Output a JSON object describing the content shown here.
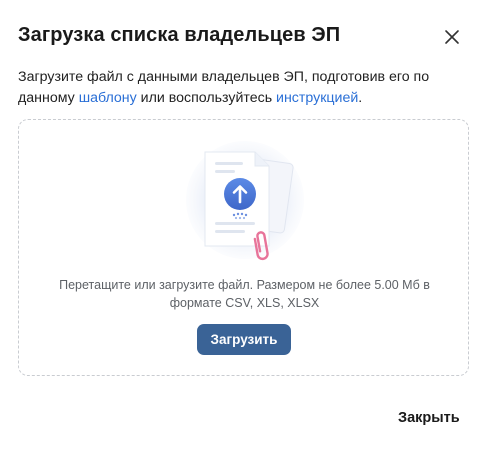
{
  "dialog": {
    "title": "Загрузка списка владельцев ЭП",
    "close_icon": "close-icon"
  },
  "description": {
    "text_before_template": "Загрузите файл с данными владельцев ЭП, подготовив его по данному ",
    "template_link": "шаблону",
    "text_between": " или воспользуйтесь ",
    "instruction_link": "инструкцией",
    "text_after": "."
  },
  "dropzone": {
    "illustration_icon": "file-upload-icon",
    "hint_line1": "Перетащите или загрузите файл. Размером не более 5.00 Мб в",
    "hint_line2": "формате CSV, XLS, XLSX",
    "upload_label": "Загрузить"
  },
  "footer": {
    "close_label": "Закрыть"
  },
  "colors": {
    "accent": "#3a6396",
    "link": "#2a6fd6",
    "upload_arrow": "#4b78d6",
    "paperclip": "#e8749a"
  }
}
